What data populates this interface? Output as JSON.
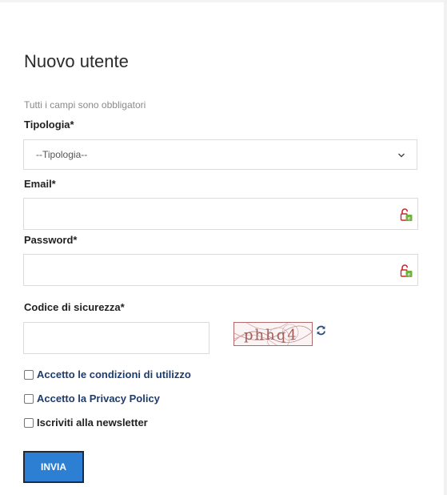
{
  "form": {
    "title": "Nuovo utente",
    "required_hint": "Tutti i campi sono obbligatori",
    "tipologia": {
      "label": "Tipologia*",
      "selected": "--Tipologia--"
    },
    "email": {
      "label": "Email*",
      "value": ""
    },
    "password": {
      "label": "Password*",
      "value": ""
    },
    "security_code": {
      "label": "Codice di sicurezza*",
      "value": "",
      "captcha_text": "phhq4"
    },
    "checkboxes": [
      {
        "label": "Accetto le condizioni di utilizzo",
        "checked": false,
        "link": true
      },
      {
        "label": "Accetto la Privacy Policy",
        "checked": false,
        "link": true
      },
      {
        "label": "Iscriviti alla newsletter",
        "checked": false,
        "link": false
      }
    ],
    "submit_label": "INVIA"
  },
  "colors": {
    "button": "#2d7fd3",
    "link": "#1d3c6e",
    "input_border": "#dcdcdc",
    "captcha_border": "#b36a6a"
  },
  "icons": {
    "field_icon": "password-manager-lock-icon",
    "refresh": "refresh-icon",
    "select_arrow": "chevron-down-icon"
  }
}
